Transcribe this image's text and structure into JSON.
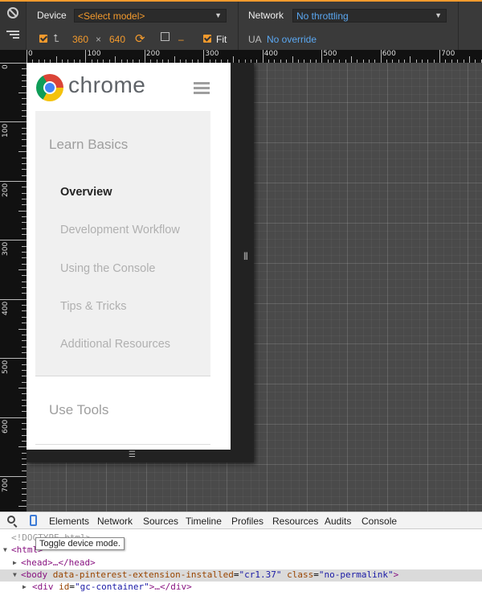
{
  "toolbar": {
    "device_label": "Device",
    "model_select": "<Select model>",
    "network_label": "Network",
    "network_select": "No throttling",
    "width": "360",
    "times": "×",
    "height": "640",
    "scale_value": "–",
    "fit_label": "Fit",
    "ua_label": "UA",
    "ua_value": "No override",
    "accent_color": "#f39a2d",
    "link_color": "#5ba8f2"
  },
  "ruler": {
    "top": [
      "0",
      "100",
      "200",
      "300",
      "400",
      "500",
      "600",
      "700"
    ],
    "left": [
      "0",
      "100",
      "200",
      "300",
      "400",
      "500",
      "600",
      "700"
    ]
  },
  "page": {
    "brand": "chrome",
    "nav_heading": "Learn Basics",
    "nav_items": [
      {
        "label": "Overview",
        "active": true
      },
      {
        "label": "Development Workflow",
        "active": false
      },
      {
        "label": "Using the Console",
        "active": false
      },
      {
        "label": "Tips & Tricks",
        "active": false
      },
      {
        "label": "Additional Resources",
        "active": false
      }
    ],
    "tools_heading": "Use Tools"
  },
  "devtools": {
    "tabs": [
      "Elements",
      "Network",
      "Sources",
      "Timeline",
      "Profiles",
      "Resources",
      "Audits",
      "Console"
    ],
    "tooltip": "Toggle device mode.",
    "dom": {
      "doctype": "<!DOCTYPE html>",
      "html_open": "<html>",
      "head": "<head>…</head>",
      "body_tag": "<body",
      "body_attr1_name": "data-pinterest-extension-installed",
      "body_attr1_value": "\"cr1.37\"",
      "body_attr2_name": "class",
      "body_attr2_value": "\"no-permalink\"",
      "body_close": ">",
      "div_tag": "<div",
      "div_attr_name": "id",
      "div_attr_value": "\"gc-container\"",
      "div_rest": ">…</div>"
    }
  }
}
